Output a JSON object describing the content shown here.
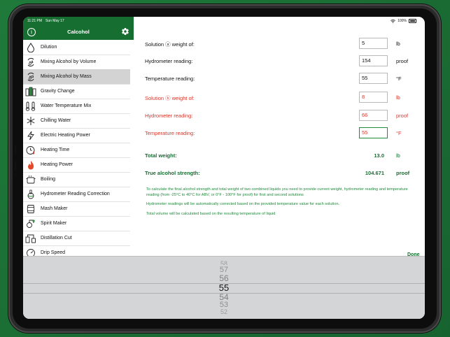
{
  "status_bar": {
    "time": "11:21 PM",
    "date": "Sun May 17",
    "battery": "100%"
  },
  "sidebar": {
    "title": "Calcohol",
    "items": [
      {
        "label": "Dilution",
        "icon": "drop-icon"
      },
      {
        "label": "Mixing Alcohol by Volume",
        "icon": "mix-volume-icon"
      },
      {
        "label": "Mixing Alcohol by Mass",
        "icon": "mix-mass-icon",
        "selected": true
      },
      {
        "label": "Gravity Change",
        "icon": "hydrometer-icon"
      },
      {
        "label": "Water Temperature Mix",
        "icon": "thermometer-icon"
      },
      {
        "label": "Chilling Water",
        "icon": "snowflake-icon"
      },
      {
        "label": "Electric Heating Power",
        "icon": "lightning-icon"
      },
      {
        "label": "Heating Time",
        "icon": "timer-icon"
      },
      {
        "label": "Heating Power",
        "icon": "flame-icon"
      },
      {
        "label": "Boiling",
        "icon": "pot-icon"
      },
      {
        "label": "Hydrometer Reading Correction",
        "icon": "hydrometer-correction-icon"
      },
      {
        "label": "Mash Maker",
        "icon": "barrel-icon"
      },
      {
        "label": "Spirit Maker",
        "icon": "still-icon"
      },
      {
        "label": "Distillation Cut",
        "icon": "distill-icon"
      },
      {
        "label": "Drip Speed",
        "icon": "drip-gauge-icon"
      }
    ]
  },
  "form": {
    "solution_a": [
      {
        "label": "Solution ⓐ weight of:",
        "value": "5",
        "unit": "lb"
      },
      {
        "label": "Hydrometer reading:",
        "value": "154",
        "unit": "proof"
      },
      {
        "label": "Temperature reading:",
        "value": "55",
        "unit": "°F"
      }
    ],
    "solution_b": [
      {
        "label": "Solution ⓑ weight of:",
        "value": "8",
        "unit": "lb"
      },
      {
        "label": "Hydrometer reading:",
        "value": "66",
        "unit": "proof"
      },
      {
        "label": "Temperature reading:",
        "value": "55",
        "unit": "°F"
      }
    ]
  },
  "results": {
    "total_weight": {
      "label": "Total weight:",
      "value": "13.0",
      "unit": "lb"
    },
    "true_strength": {
      "label": "True alcohol strength:",
      "value": "104.671",
      "unit": "proof"
    }
  },
  "notes": [
    "To calculate the final alcohol strength and total weight of two combined liquids you need to provide current weight, hydrometer reading and temperature reading (from -25°C to 40°C for ABV, or 0°F - 100°F for proof) for first and second solutions",
    "Hydrometer readings will be automatically corrected based on the provided temperature value for each solution.",
    "Total volume will be calculated based on the resulting temperature of liquid"
  ],
  "done_label": "Done",
  "picker": {
    "values": [
      "58",
      "57",
      "56",
      "55",
      "54",
      "53",
      "52"
    ],
    "selected": "55"
  },
  "colors": {
    "brand_green": "#166e31",
    "accent_green": "#1f8a3c",
    "error_red": "#d6372c",
    "picker_bg": "#d4d5d7"
  }
}
